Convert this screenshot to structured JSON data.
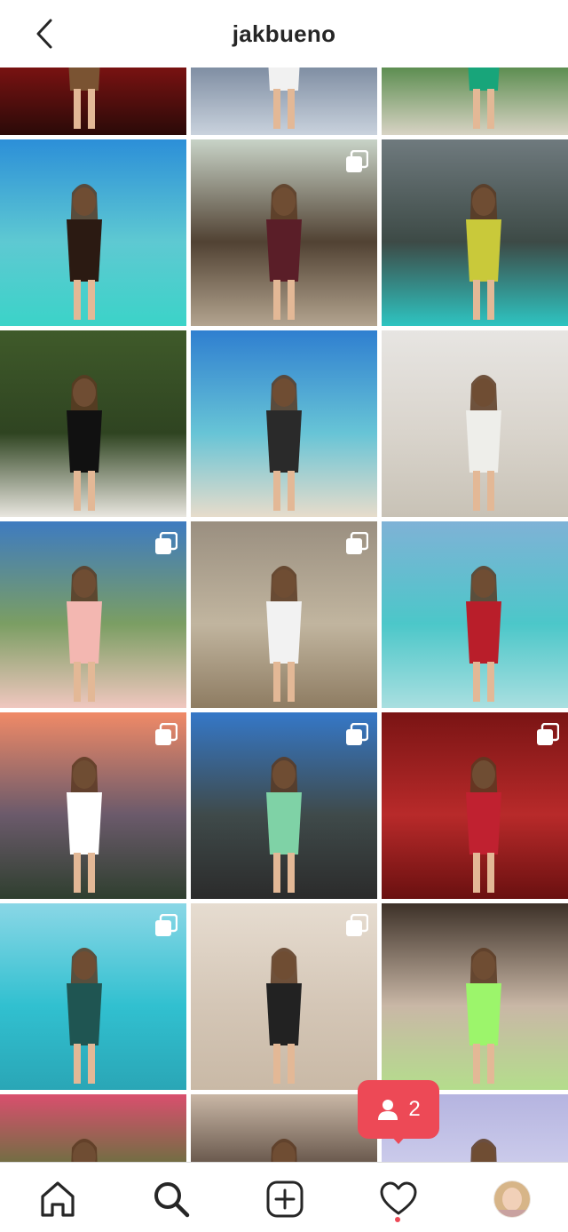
{
  "header": {
    "title": "jakbueno"
  },
  "activity": {
    "followers_count": "2"
  },
  "tiles": [
    {
      "row": -1,
      "col": 0,
      "bg": [
        "#3b1c12",
        "#8c1414",
        "#2a0a08"
      ],
      "fig": "#7a5332",
      "multi": false
    },
    {
      "row": -1,
      "col": 1,
      "bg": [
        "#f4a37d",
        "#6e7e95",
        "#c9d2dd"
      ],
      "fig": "#f1f1f1",
      "multi": false
    },
    {
      "row": -1,
      "col": 2,
      "bg": [
        "#8aa96a",
        "#3f7d35",
        "#d8d3c4"
      ],
      "fig": "#18a57a",
      "multi": false
    },
    {
      "row": 0,
      "col": 0,
      "bg": [
        "#2c8fd8",
        "#5ec9d2",
        "#3bd3c8"
      ],
      "fig": "#2b1a12",
      "multi": false
    },
    {
      "row": 0,
      "col": 1,
      "bg": [
        "#c8d3c7",
        "#514233",
        "#b3a48f"
      ],
      "fig": "#5a1e28",
      "multi": true
    },
    {
      "row": 0,
      "col": 2,
      "bg": [
        "#6f7a7e",
        "#3d4a46",
        "#2ec4c1"
      ],
      "fig": "#c9c93a",
      "multi": false
    },
    {
      "row": 1,
      "col": 0,
      "bg": [
        "#3f5a2a",
        "#2f4421",
        "#e9e6df"
      ],
      "fig": "#111111",
      "multi": false
    },
    {
      "row": 1,
      "col": 1,
      "bg": [
        "#2f7fd0",
        "#67c4d6",
        "#e7dccb"
      ],
      "fig": "#2a2a2a",
      "multi": false
    },
    {
      "row": 1,
      "col": 2,
      "bg": [
        "#e7e5e2",
        "#d9d4cc",
        "#c8c2b6"
      ],
      "fig": "#eeeeea",
      "multi": false
    },
    {
      "row": 2,
      "col": 0,
      "bg": [
        "#3e7bc0",
        "#7b9e63",
        "#f0c7bf"
      ],
      "fig": "#f3b7b1",
      "multi": true
    },
    {
      "row": 2,
      "col": 1,
      "bg": [
        "#9a8f80",
        "#c1b59f",
        "#8e7c62"
      ],
      "fig": "#f2f2f2",
      "multi": true
    },
    {
      "row": 2,
      "col": 2,
      "bg": [
        "#7fb2d6",
        "#4cc7c9",
        "#a9dfe0"
      ],
      "fig": "#b91e2a",
      "multi": false
    },
    {
      "row": 3,
      "col": 0,
      "bg": [
        "#f08a67",
        "#6b5a6b",
        "#2f3f2f"
      ],
      "fig": "#ffffff",
      "multi": true
    },
    {
      "row": 3,
      "col": 1,
      "bg": [
        "#3578c8",
        "#3f4a4a",
        "#2b2b2b"
      ],
      "fig": "#7fd2a6",
      "multi": true
    },
    {
      "row": 3,
      "col": 2,
      "bg": [
        "#7a1414",
        "#b82a2a",
        "#6a1010"
      ],
      "fig": "#c02130",
      "multi": true
    },
    {
      "row": 4,
      "col": 0,
      "bg": [
        "#8ad7e6",
        "#31c0d0",
        "#2aa6b6"
      ],
      "fig": "#1f5552",
      "multi": true
    },
    {
      "row": 4,
      "col": 1,
      "bg": [
        "#e6dcd0",
        "#d4c6b6",
        "#c9b9a6"
      ],
      "fig": "#222222",
      "multi": true
    },
    {
      "row": 4,
      "col": 2,
      "bg": [
        "#3d3128",
        "#c9b7a6",
        "#b4dd8c"
      ],
      "fig": "#9cf56b",
      "multi": false
    },
    {
      "row": 5,
      "col": 0,
      "bg": [
        "#d94f6e",
        "#3f7d2e",
        "#8abf5f"
      ],
      "fig": "#2a2a2a",
      "multi": false
    },
    {
      "row": 5,
      "col": 1,
      "bg": [
        "#c9b7a6",
        "#3a2a21",
        "#d6c7b7"
      ],
      "fig": "#4a3428",
      "multi": false
    },
    {
      "row": 5,
      "col": 2,
      "bg": [
        "#b5b4e0",
        "#d6d6f0",
        "#c0c0e8"
      ],
      "fig": "#ffffff",
      "multi": false
    }
  ],
  "tabs": [
    {
      "name": "home"
    },
    {
      "name": "search"
    },
    {
      "name": "new-post"
    },
    {
      "name": "activity"
    },
    {
      "name": "profile"
    }
  ],
  "colors": {
    "accent": "#ed4956",
    "text": "#262626",
    "divider": "#dbdbdb"
  }
}
